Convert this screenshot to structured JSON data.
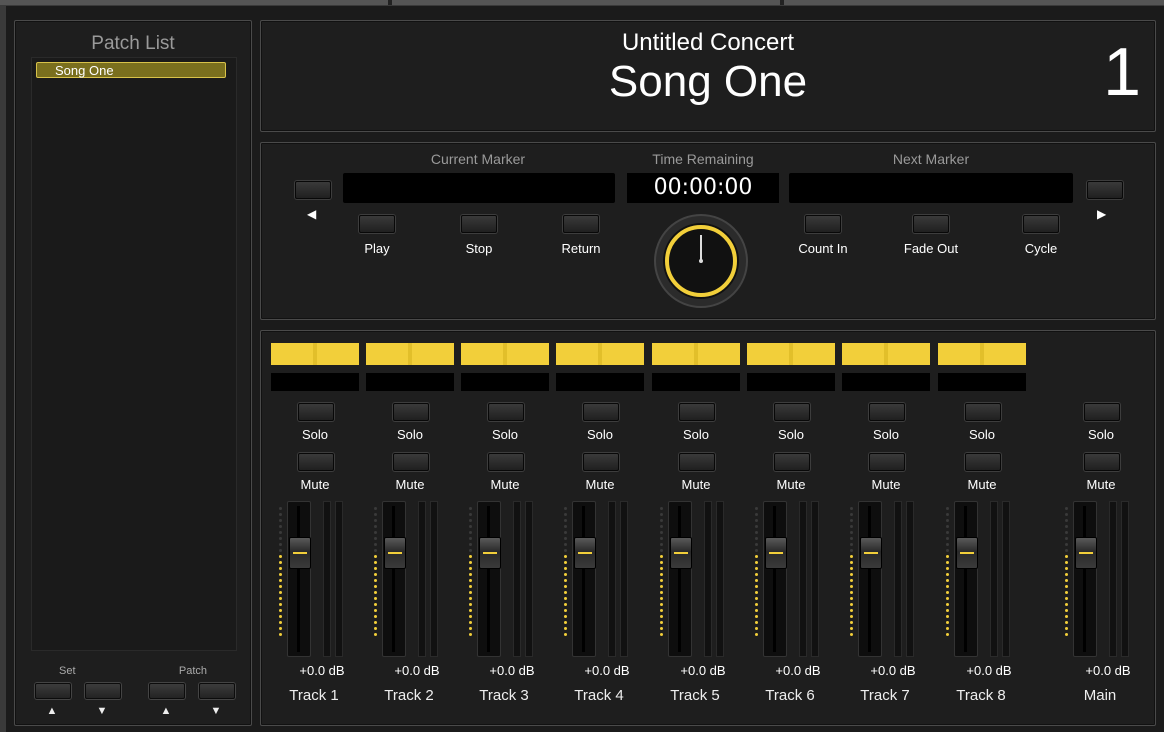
{
  "patch_list": {
    "title": "Patch List",
    "items": [
      {
        "label": "Song One",
        "selected": true
      }
    ],
    "set_label": "Set",
    "patch_label": "Patch",
    "up_glyph": "▲",
    "down_glyph": "▼"
  },
  "header": {
    "concert": "Untitled Concert",
    "song": "Song One",
    "patch_number": "1"
  },
  "transport": {
    "current_marker_label": "Current Marker",
    "time_remaining_label": "Time Remaining",
    "time_remaining": "00:00:00",
    "next_marker_label": "Next Marker",
    "prev_glyph": "◀",
    "next_glyph": "▶",
    "buttons": [
      "Play",
      "Stop",
      "Return",
      "Count In",
      "Fade Out",
      "Cycle"
    ]
  },
  "mixer": {
    "solo_label": "Solo",
    "mute_label": "Mute",
    "channels": [
      {
        "name": "Track 1",
        "db": "+0.0 dB"
      },
      {
        "name": "Track 2",
        "db": "+0.0 dB"
      },
      {
        "name": "Track 3",
        "db": "+0.0 dB"
      },
      {
        "name": "Track 4",
        "db": "+0.0 dB"
      },
      {
        "name": "Track 5",
        "db": "+0.0 dB"
      },
      {
        "name": "Track 6",
        "db": "+0.0 dB"
      },
      {
        "name": "Track 7",
        "db": "+0.0 dB"
      },
      {
        "name": "Track 8",
        "db": "+0.0 dB"
      },
      {
        "name": "Main",
        "db": "+0.0 dB"
      }
    ]
  },
  "colors": {
    "accent": "#f2cf3a",
    "background": "#1e1e1e",
    "display": "#000000"
  }
}
